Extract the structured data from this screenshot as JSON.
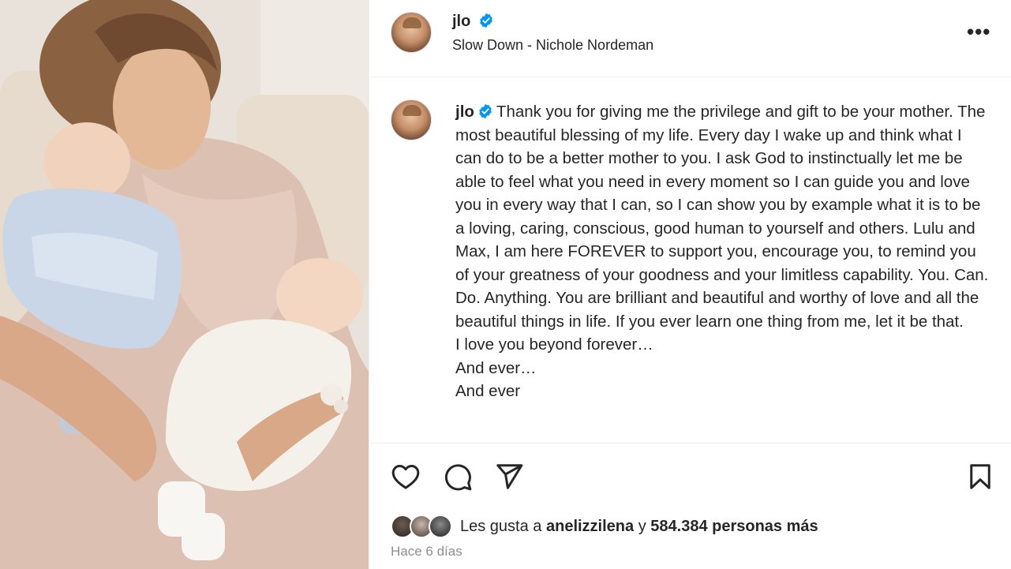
{
  "post": {
    "username": "jlo",
    "audio": "Slow Down - Nichole Nordeman",
    "more_label": "•••",
    "caption_username": "jlo",
    "caption_lines": [
      "Thank you for giving me the privilege and gift to be your mother. The most beautiful blessing of my life. Every day I wake up and think what I can do to be a better mother to you. I ask God to instinctually let me be able to feel what you need in every moment so I can guide you and love you in every way that I can, so I can show you by example what it is to be a loving, caring, conscious, good human to yourself and others. Lulu and Max, I am here FOREVER to support you, encourage you, to remind you of your greatness of your goodness and your limitless capability. You. Can. Do. Anything. You are brilliant and beautiful and worthy of love and all the beautiful things in life. If you ever learn one thing from me, let it be that.",
      "I love you beyond forever…",
      "And ever…",
      "And ever"
    ],
    "likes": {
      "prefix": "Les gusta a",
      "user": "anelizzilena",
      "connector": "y",
      "count": "584.384 personas más"
    },
    "timestamp": "Hace 6 días"
  },
  "icons": {
    "like": "heart-icon",
    "comment": "comment-icon",
    "share": "send-icon",
    "save": "bookmark-icon",
    "verified": "verified-badge-icon",
    "more": "more-options-icon"
  },
  "colors": {
    "verified": "#0095f6",
    "text": "#262626",
    "secondary": "#8e8e8e",
    "divider": "#efefef"
  }
}
